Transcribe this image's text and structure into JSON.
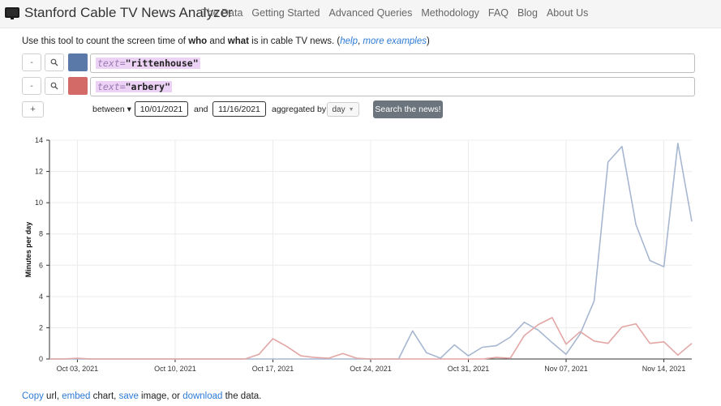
{
  "app": {
    "title": "Stanford Cable TV News Analyzer"
  },
  "nav": {
    "items": [
      "The Data",
      "Getting Started",
      "Advanced Queries",
      "Methodology",
      "FAQ",
      "Blog",
      "About Us"
    ]
  },
  "intro": {
    "prefix": "Use this tool to count the screen time of ",
    "who": "who",
    "and": " and ",
    "what": "what",
    "suffix": " is in cable TV news. (",
    "help_link": "help",
    "comma": ", ",
    "examples_link": "more examples",
    "close": ")"
  },
  "queries": [
    {
      "minus": "-",
      "search_icon": "magnifier-icon",
      "color": "#5b79a8",
      "key": "text=",
      "value": "\"rittenhouse\""
    },
    {
      "minus": "-",
      "search_icon": "magnifier-icon",
      "color": "#d46a68",
      "key": "text=",
      "value": "\"arbery\""
    }
  ],
  "controls": {
    "add": "+",
    "between": "between",
    "start_date": "10/01/2021",
    "and": "and",
    "end_date": "11/16/2021",
    "aggregated_by": "aggregated by",
    "aggregation": "day",
    "search": "Search the news!"
  },
  "chart_data": {
    "type": "line",
    "title": "",
    "xlabel": "",
    "ylabel": "Minutes per day",
    "ylim": [
      0,
      14
    ],
    "yticks": [
      0,
      2,
      4,
      6,
      8,
      10,
      12,
      14
    ],
    "xticks": [
      "Oct 03, 2021",
      "Oct 10, 2021",
      "Oct 17, 2021",
      "Oct 24, 2021",
      "Oct 31, 2021",
      "Nov 07, 2021",
      "Nov 14, 2021"
    ],
    "grid": true,
    "x": [
      "Oct 01",
      "Oct 02",
      "Oct 03",
      "Oct 04",
      "Oct 05",
      "Oct 06",
      "Oct 07",
      "Oct 08",
      "Oct 09",
      "Oct 10",
      "Oct 11",
      "Oct 12",
      "Oct 13",
      "Oct 14",
      "Oct 15",
      "Oct 16",
      "Oct 17",
      "Oct 18",
      "Oct 19",
      "Oct 20",
      "Oct 21",
      "Oct 22",
      "Oct 23",
      "Oct 24",
      "Oct 25",
      "Oct 26",
      "Oct 27",
      "Oct 28",
      "Oct 29",
      "Oct 30",
      "Oct 31",
      "Nov 01",
      "Nov 02",
      "Nov 03",
      "Nov 04",
      "Nov 05",
      "Nov 06",
      "Nov 07",
      "Nov 08",
      "Nov 09",
      "Nov 10",
      "Nov 11",
      "Nov 12",
      "Nov 13",
      "Nov 14",
      "Nov 15",
      "Nov 16"
    ],
    "series": [
      {
        "color": "#a7b7d0",
        "values": [
          0,
          0,
          0,
          0,
          0,
          0,
          0,
          0,
          0,
          0,
          0,
          0,
          0,
          0,
          0,
          0,
          0,
          0,
          0,
          0,
          0,
          0,
          0,
          0,
          0,
          0,
          1.8,
          0.4,
          0.05,
          0.9,
          0.2,
          0.75,
          0.85,
          1.4,
          2.35,
          1.85,
          1.05,
          0.3,
          1.6,
          3.7,
          12.6,
          13.6,
          8.6,
          6.3,
          5.9,
          13.8,
          8.8
        ]
      },
      {
        "color": "#e2a6a4",
        "values": [
          0,
          0,
          0.05,
          0,
          0,
          0,
          0,
          0,
          0,
          0,
          0,
          0,
          0,
          0,
          0,
          0.3,
          1.3,
          0.8,
          0.2,
          0.1,
          0.05,
          0.35,
          0.05,
          0,
          0,
          0,
          0,
          0,
          0,
          0,
          0,
          0,
          0.1,
          0.05,
          1.5,
          2.2,
          2.65,
          0.95,
          1.75,
          1.15,
          1.0,
          2.05,
          2.25,
          1.0,
          1.1,
          0.25,
          1.0
        ]
      }
    ]
  },
  "footer": {
    "copy": "Copy",
    "t1": " url, ",
    "embed": "embed",
    "t2": " chart, ",
    "save": "save",
    "t3": " image, or ",
    "download": "download",
    "t4": " the data."
  }
}
